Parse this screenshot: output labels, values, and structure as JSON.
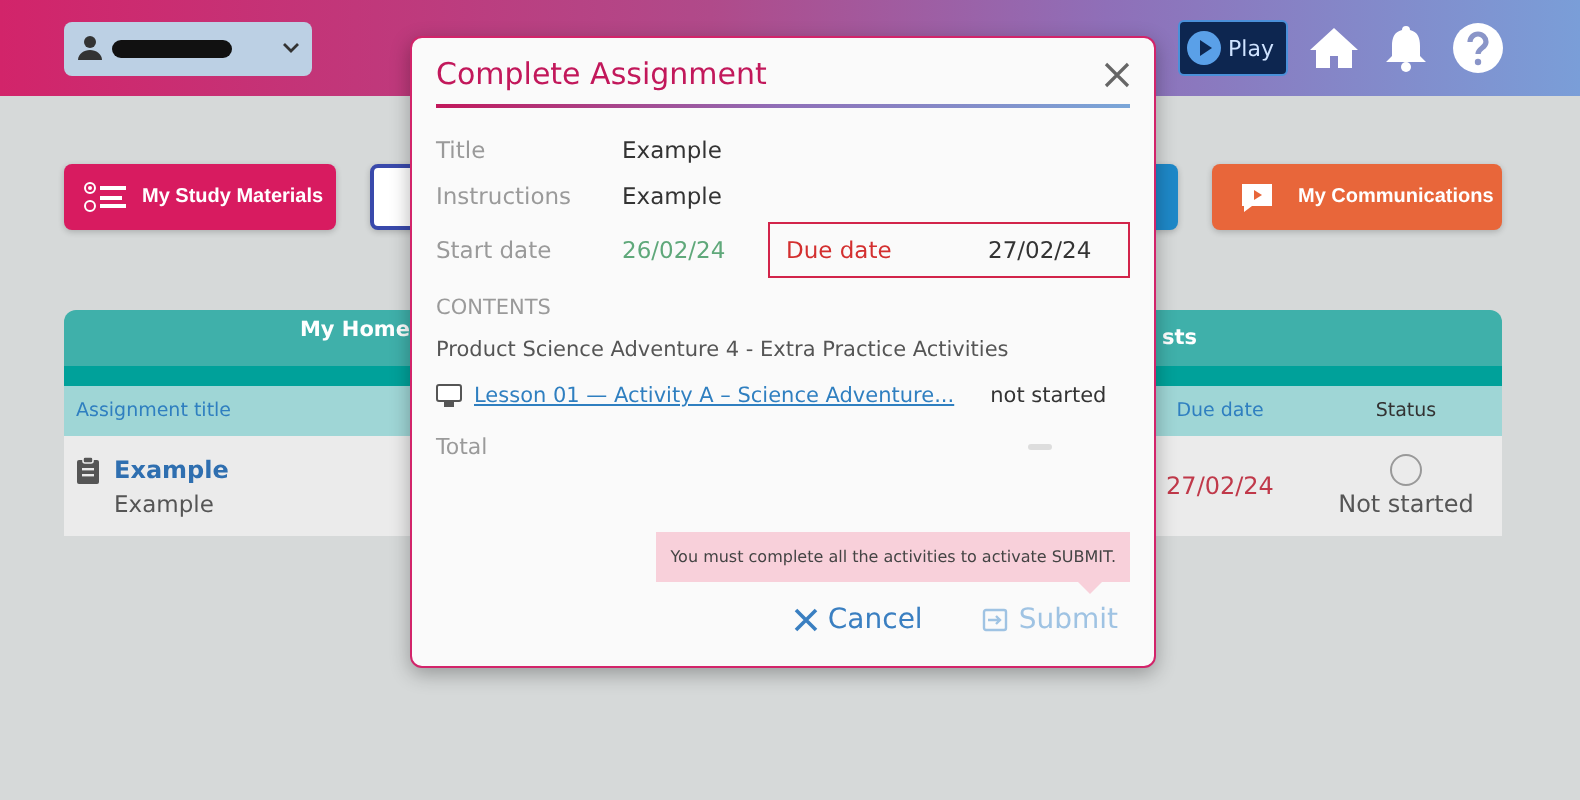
{
  "header": {
    "play_label": "Play"
  },
  "nav_buttons": [
    {
      "label": "My Study Materials",
      "kind": "filled",
      "color": "#d81b60"
    },
    {
      "kind": "outlined",
      "color": "#3949ab"
    },
    {
      "kind": "filled",
      "color": "#1e88c8"
    },
    {
      "label": "My Communications",
      "kind": "filled",
      "color": "#e8663a"
    }
  ],
  "table": {
    "heading_left": "My Home",
    "heading_right": "sts",
    "columns": [
      "Assignment title",
      "Due date",
      "Status"
    ],
    "rows": [
      {
        "title": "Example",
        "subtitle": "Example",
        "due": "27/02/24",
        "status": "Not started"
      }
    ]
  },
  "dialog": {
    "title": "Complete Assignment",
    "fields": [
      {
        "label": "Title",
        "value": "Example"
      },
      {
        "label": "Instructions",
        "value": "Example"
      }
    ],
    "start_label": "Start date",
    "start_value": "26/02/24",
    "due_label": "Due date",
    "due_value": "27/02/24",
    "contents_label": "CONTENTS",
    "product": "Product Science Adventure 4 - Extra Practice Activities",
    "activities": [
      {
        "title": "Lesson 01 — Activity A – Science Adventure...",
        "status": "not started"
      }
    ],
    "total_label": "Total",
    "tooltip": "You must complete all the activities to activate SUBMIT.",
    "cancel": "Cancel",
    "submit": "Submit",
    "submit_disabled": true
  }
}
